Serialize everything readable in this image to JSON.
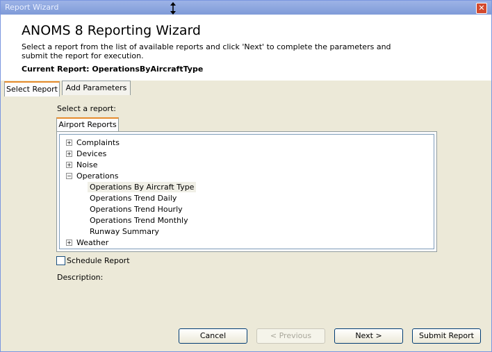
{
  "window": {
    "title": "Report Wizard",
    "close_glyph": "✕"
  },
  "header": {
    "title": "ANOMS 8 Reporting Wizard",
    "instructions": "Select a report from the list of available reports and click 'Next' to complete the parameters and submit the report for execution.",
    "current_report": "Current Report: OperationsByAircraftType"
  },
  "tabs": [
    {
      "label": "Select Report",
      "active": true
    },
    {
      "label": "Add Parameters",
      "active": false
    }
  ],
  "select_report": {
    "prompt": "Select a report:",
    "subtab": "Airport Reports",
    "tree": [
      {
        "label": "Complaints",
        "expanded": false,
        "expander": "+"
      },
      {
        "label": "Devices",
        "expanded": false,
        "expander": "+"
      },
      {
        "label": "Noise",
        "expanded": false,
        "expander": "+"
      },
      {
        "label": "Operations",
        "expanded": true,
        "expander": "−",
        "children": [
          {
            "label": "Operations By Aircraft Type",
            "selected": true
          },
          {
            "label": "Operations Trend Daily"
          },
          {
            "label": "Operations Trend Hourly"
          },
          {
            "label": "Operations Trend Monthly"
          },
          {
            "label": "Runway Summary"
          }
        ]
      },
      {
        "label": "Weather",
        "expanded": false,
        "expander": "+"
      }
    ],
    "schedule_label": "Schedule Report",
    "schedule_checked": false,
    "description_label": "Description:"
  },
  "buttons": {
    "cancel": "Cancel",
    "previous": "< Previous",
    "next": "Next >",
    "submit": "Submit Report"
  },
  "colors": {
    "titlebar": "#7f9bd8",
    "tab_highlight": "#e68b2c",
    "panel": "#ece9d8"
  },
  "icons": [
    "resize-cursor-icon",
    "close-icon",
    "expand-plus-icon",
    "collapse-minus-icon"
  ]
}
